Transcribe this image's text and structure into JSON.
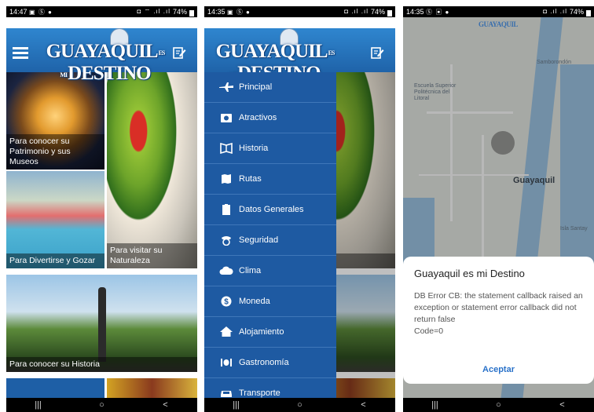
{
  "screens": [
    {
      "id": "home",
      "status": {
        "time": "14:47",
        "left_icons": "▣ Ⓢ ●",
        "right_icons": "◘ ⌔ .ıl .ıl",
        "battery": "74%"
      },
      "header": {
        "logo_text": "GUAYAQUIL",
        "logo_small": "ES MI",
        "logo_tail": "DESTINO"
      },
      "tiles": [
        {
          "caption": "Para conocer su Patrimonio y sus Museos"
        },
        {
          "caption": "Para Divertirse y Gozar"
        },
        {
          "caption": "Para visitar su Naturaleza"
        },
        {
          "caption": "Para conocer su Historia"
        }
      ],
      "nav": [
        "|||",
        "○",
        "<"
      ]
    },
    {
      "id": "menu",
      "status": {
        "time": "14:35",
        "left_icons": "▣ Ⓢ ●",
        "right_icons": "◘ .ıl .ıl",
        "battery": "74%"
      },
      "header": {
        "logo_text": "GUAYAQUIL",
        "logo_small": "ES MI",
        "logo_tail": "DESTINO"
      },
      "background_captions": [
        "sitar su",
        "eza"
      ],
      "menu_items": [
        {
          "label": "Principal",
          "icon": "plane-icon"
        },
        {
          "label": "Atractivos",
          "icon": "camera-icon"
        },
        {
          "label": "Historia",
          "icon": "book-icon"
        },
        {
          "label": "Rutas",
          "icon": "map-icon"
        },
        {
          "label": "Datos Generales",
          "icon": "clipboard-icon"
        },
        {
          "label": "Seguridad",
          "icon": "police-icon"
        },
        {
          "label": "Clima",
          "icon": "cloud-icon"
        },
        {
          "label": "Moneda",
          "icon": "dollar-icon"
        },
        {
          "label": "Alojamiento",
          "icon": "home-icon"
        },
        {
          "label": "Gastronomía",
          "icon": "utensils-icon"
        },
        {
          "label": "Transporte",
          "icon": "car-icon"
        }
      ],
      "nav": [
        "|||",
        "○",
        "<"
      ]
    },
    {
      "id": "map-error",
      "status": {
        "time": "14:35",
        "left_icons": "Ⓢ ▣ ●",
        "right_icons": "◘ .ıl .ıl",
        "battery": "74%"
      },
      "map_labels": [
        "Samborondón",
        "Escuela Superior Politécnica del Litoral",
        "Guayaquil",
        "Isla Santay"
      ],
      "dialog": {
        "title": "Guayaquil es mi Destino",
        "message": "DB Error CB: the statement callback raised an exception or statement error callback did not return false",
        "code": "Code=0",
        "button": "Aceptar"
      },
      "nav": [
        "|||",
        "○",
        "<"
      ]
    }
  ]
}
